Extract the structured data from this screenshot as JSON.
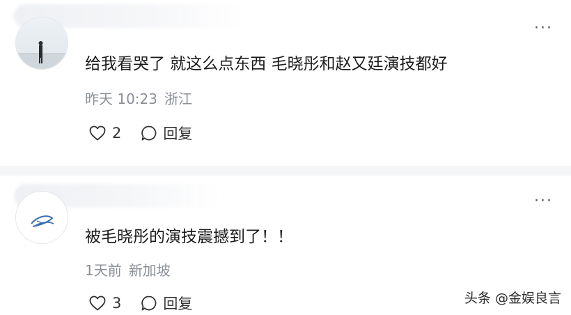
{
  "comments": [
    {
      "text": "给我看哭了 就这么点东西 毛晓彤和赵又廷演技都好",
      "time": "昨天 10:23",
      "location": "浙江",
      "likes": "2",
      "reply_label": "回复"
    },
    {
      "text": "被毛晓彤的演技震撼到了！！",
      "time": "1天前",
      "location": "新加坡",
      "likes": "3",
      "reply_label": "回复"
    }
  ],
  "more_label": "···",
  "watermark": "头条 @金娱良言",
  "icons": {
    "like": "heart-icon",
    "reply": "comment-bubble-icon",
    "more": "more-dots-icon"
  }
}
